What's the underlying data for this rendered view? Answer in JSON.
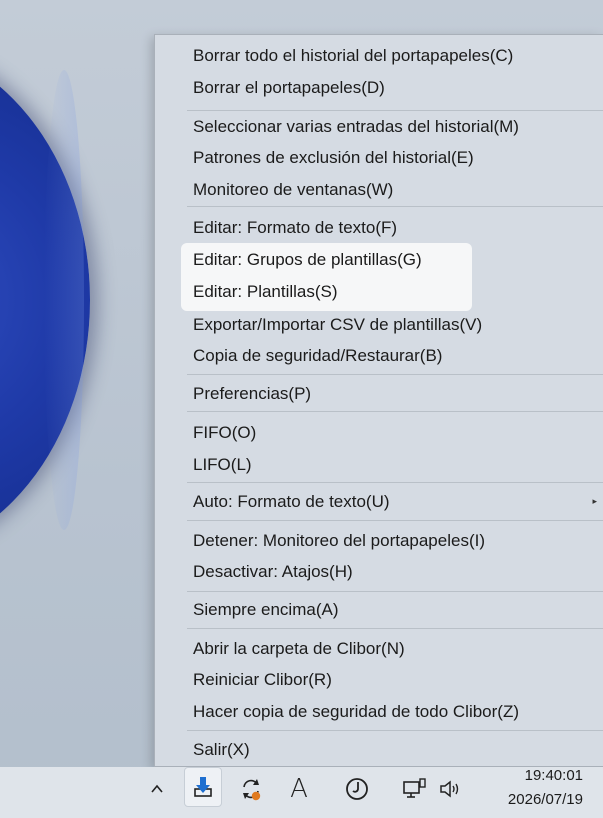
{
  "menu": {
    "items": [
      {
        "label": "Borrar todo el historial del portapapeles(C)"
      },
      {
        "label": "Borrar el portapapeles(D)"
      },
      {
        "label": "Seleccionar varias entradas del historial(M)"
      },
      {
        "label": "Patrones de exclusión del historial(E)"
      },
      {
        "label": "Monitoreo de ventanas(W)"
      },
      {
        "label": "Editar: Formato de texto(F)"
      },
      {
        "label": "Editar: Grupos de plantillas(G)"
      },
      {
        "label": "Editar: Plantillas(S)"
      },
      {
        "label": "Exportar/Importar CSV de plantillas(V)"
      },
      {
        "label": "Copia de seguridad/Restaurar(B)"
      },
      {
        "label": "Preferencias(P)"
      },
      {
        "label": "FIFO(O)"
      },
      {
        "label": "LIFO(L)"
      },
      {
        "label": "Auto: Formato de texto(U)"
      },
      {
        "label": "Detener: Monitoreo del portapapeles(I)"
      },
      {
        "label": "Desactivar: Atajos(H)"
      },
      {
        "label": "Siempre encima(A)"
      },
      {
        "label": "Abrir la carpeta de Clibor(N)"
      },
      {
        "label": "Reiniciar Clibor(R)"
      },
      {
        "label": "Hacer copia de seguridad de todo Clibor(Z)"
      },
      {
        "label": "Salir(X)"
      }
    ],
    "submenu_arrow": "▸"
  },
  "taskbar": {
    "chevron": "^",
    "font_icon_letter": "A",
    "time": "19:40:01",
    "date": "2026/07/19"
  },
  "colors": {
    "menu_bg": "#d5dbe3",
    "highlight_bg": "#f6f7f8",
    "wallpaper_blue": "#1f3aa8",
    "clibor_accent": "#1e6fd0",
    "sync_badge": "#e07a1f"
  }
}
